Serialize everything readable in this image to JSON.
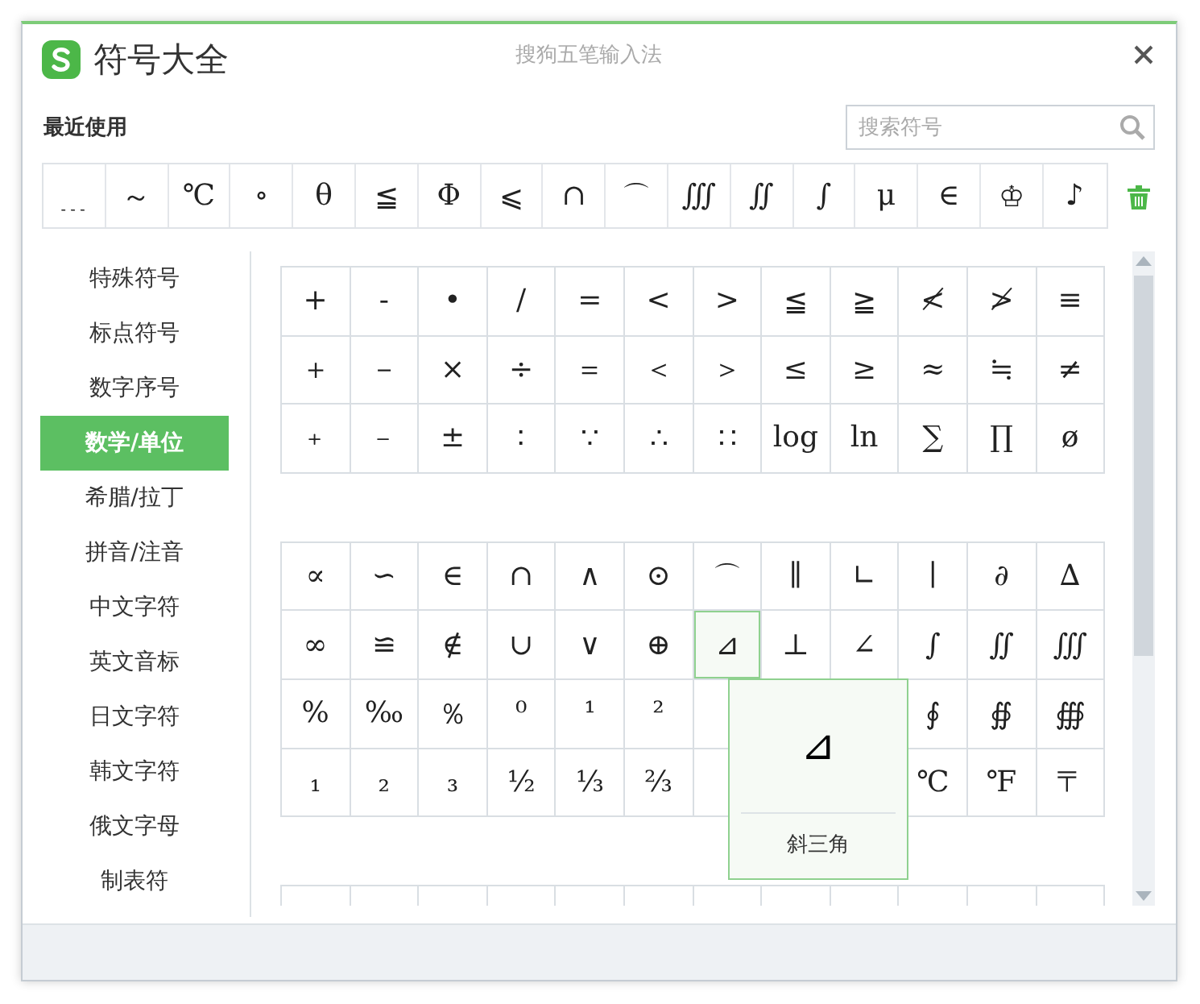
{
  "window": {
    "title": "符号大全",
    "subtitle": "搜狗五笔输入法"
  },
  "recent": {
    "label": "最近使用",
    "symbols": [
      "﹍",
      "～",
      "℃",
      "∘",
      "θ",
      "≦",
      "Φ",
      "⩽",
      "∩",
      "⌒",
      "∭",
      "∬",
      "∫",
      "μ",
      "∈",
      "♔",
      "♪"
    ]
  },
  "search": {
    "placeholder": "搜索符号"
  },
  "sidebar": {
    "items": [
      {
        "label": "特殊符号",
        "selected": false
      },
      {
        "label": "标点符号",
        "selected": false
      },
      {
        "label": "数字序号",
        "selected": false
      },
      {
        "label": "数学/单位",
        "selected": true
      },
      {
        "label": "希腊/拉丁",
        "selected": false
      },
      {
        "label": "拼音/注音",
        "selected": false
      },
      {
        "label": "中文字符",
        "selected": false
      },
      {
        "label": "英文音标",
        "selected": false
      },
      {
        "label": "日文字符",
        "selected": false
      },
      {
        "label": "韩文字符",
        "selected": false
      },
      {
        "label": "俄文字母",
        "selected": false
      },
      {
        "label": "制表符",
        "selected": false
      }
    ]
  },
  "grids": [
    {
      "rows": [
        [
          {
            "t": "+",
            "selected": false
          },
          {
            "t": "-",
            "selected": false
          },
          {
            "t": "•",
            "selected": false
          },
          {
            "t": "/",
            "selected": false
          },
          {
            "t": "=",
            "selected": false
          },
          {
            "t": "<",
            "selected": false
          },
          {
            "t": ">",
            "selected": false
          },
          {
            "t": "≦",
            "selected": false
          },
          {
            "t": "≧",
            "selected": false
          },
          {
            "t": "≮",
            "selected": false
          },
          {
            "t": "≯",
            "selected": false
          },
          {
            "t": "≡",
            "selected": false
          }
        ],
        [
          {
            "t": "＋",
            "selected": false
          },
          {
            "t": "－",
            "selected": false
          },
          {
            "t": "×",
            "selected": false
          },
          {
            "t": "÷",
            "selected": false
          },
          {
            "t": "＝",
            "selected": false
          },
          {
            "t": "＜",
            "selected": false
          },
          {
            "t": "＞",
            "selected": false
          },
          {
            "t": "≤",
            "selected": false
          },
          {
            "t": "≥",
            "selected": false
          },
          {
            "t": "≈",
            "selected": false
          },
          {
            "t": "≒",
            "selected": false
          },
          {
            "t": "≠",
            "selected": false
          }
        ],
        [
          {
            "t": "﹢",
            "selected": false
          },
          {
            "t": "﹣",
            "selected": false
          },
          {
            "t": "±",
            "selected": false
          },
          {
            "t": "∶",
            "selected": false
          },
          {
            "t": "∵",
            "selected": false
          },
          {
            "t": "∴",
            "selected": false
          },
          {
            "t": "∷",
            "selected": false
          },
          {
            "t": "log",
            "selected": false
          },
          {
            "t": "ln",
            "selected": false
          },
          {
            "t": "∑",
            "selected": false
          },
          {
            "t": "∏",
            "selected": false
          },
          {
            "t": "ø",
            "selected": false
          }
        ]
      ]
    },
    {
      "rows": [
        [
          {
            "t": "∝",
            "selected": false
          },
          {
            "t": "∽",
            "selected": false
          },
          {
            "t": "∈",
            "selected": false
          },
          {
            "t": "∩",
            "selected": false
          },
          {
            "t": "∧",
            "selected": false
          },
          {
            "t": "⊙",
            "selected": false
          },
          {
            "t": "⌒",
            "selected": false
          },
          {
            "t": "∥",
            "selected": false
          },
          {
            "t": "∟",
            "selected": false
          },
          {
            "t": "∣",
            "selected": false
          },
          {
            "t": "∂",
            "selected": false
          },
          {
            "t": "∆",
            "selected": false
          }
        ],
        [
          {
            "t": "∞",
            "selected": false
          },
          {
            "t": "≌",
            "selected": false
          },
          {
            "t": "∉",
            "selected": false
          },
          {
            "t": "∪",
            "selected": false
          },
          {
            "t": "∨",
            "selected": false
          },
          {
            "t": "⊕",
            "selected": false
          },
          {
            "t": "⊿",
            "selected": true
          },
          {
            "t": "⊥",
            "selected": false
          },
          {
            "t": "∠",
            "selected": false
          },
          {
            "t": "∫",
            "selected": false
          },
          {
            "t": "∬",
            "selected": false
          },
          {
            "t": "∭",
            "selected": false
          }
        ],
        [
          {
            "t": "%",
            "selected": false
          },
          {
            "t": "‰",
            "selected": false
          },
          {
            "t": "％",
            "selected": false
          },
          {
            "t": "⁰",
            "selected": false
          },
          {
            "t": "¹",
            "selected": false
          },
          {
            "t": "²",
            "selected": false
          },
          null,
          null,
          null,
          {
            "t": "∮",
            "selected": false
          },
          {
            "t": "∯",
            "selected": false
          },
          {
            "t": "∰",
            "selected": false
          }
        ],
        [
          {
            "t": "₁",
            "selected": false
          },
          {
            "t": "₂",
            "selected": false
          },
          {
            "t": "₃",
            "selected": false
          },
          {
            "t": "½",
            "selected": false
          },
          {
            "t": "⅓",
            "selected": false
          },
          {
            "t": "⅔",
            "selected": false
          },
          null,
          null,
          null,
          {
            "t": "℃",
            "selected": false
          },
          {
            "t": "℉",
            "selected": false
          },
          {
            "t": "〒",
            "selected": false
          }
        ]
      ]
    }
  ],
  "tooltip": {
    "symbol": "⊿",
    "label": "斜三角"
  }
}
